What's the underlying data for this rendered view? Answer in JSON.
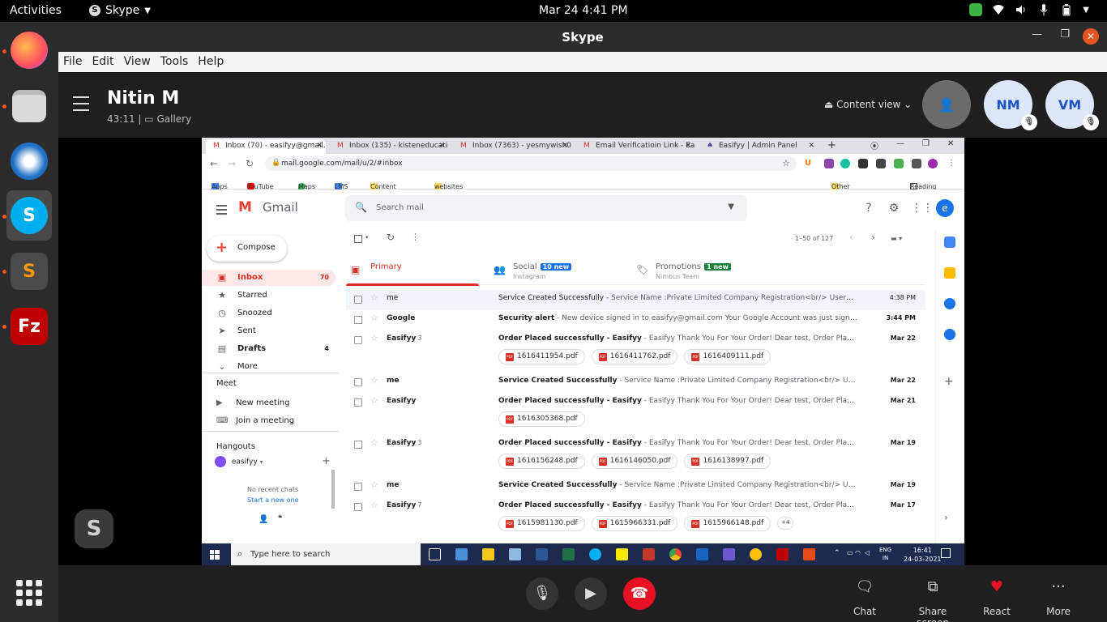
{
  "ubuntu": {
    "activities": "Activities",
    "app_name": "Skype",
    "clock": "Mar 24  4:41 PM"
  },
  "skype": {
    "window_title": "Skype",
    "menu": [
      "File",
      "Edit",
      "View",
      "Tools",
      "Help"
    ],
    "call_name": "Nitin M",
    "call_timer": "43:11",
    "call_view": "Gallery",
    "content_view_label": "Content view",
    "participants": [
      "NM",
      "VM"
    ],
    "actions": [
      "Chat",
      "Share screen",
      "React",
      "More"
    ]
  },
  "chrome": {
    "tabs": [
      "Inbox (70) - easifyy@gmail.c",
      "Inbox (135) - kisteneducation",
      "Inbox (7363) - yesmywish0@",
      "Email Verificatioin Link - Easif",
      "Easifyy | Admin Panel"
    ],
    "url": "mail.google.com/mail/u/2/#inbox",
    "bookmarks": [
      "Apps",
      "YouTube",
      "Maps",
      "LMS",
      "Content Tools",
      "websites"
    ],
    "other_bookmarks": "Other bookmarks",
    "reading_list": "Reading list"
  },
  "gmail": {
    "logo_text": "Gmail",
    "search_placeholder": "Search mail",
    "account_initial": "e",
    "compose": "Compose",
    "nav": [
      {
        "label": "Inbox",
        "count": "70"
      },
      {
        "label": "Starred",
        "count": ""
      },
      {
        "label": "Snoozed",
        "count": ""
      },
      {
        "label": "Sent",
        "count": ""
      },
      {
        "label": "Drafts",
        "count": "4"
      },
      {
        "label": "More",
        "count": ""
      }
    ],
    "meet_heading": "Meet",
    "meet_items": [
      "New meeting",
      "Join a meeting"
    ],
    "hangouts_heading": "Hangouts",
    "hangouts_user": "easifyy",
    "no_chats": "No recent chats",
    "start_chat": "Start a new one",
    "pagination": "1–50 of 127",
    "categories": [
      {
        "name": "Primary",
        "sub": "",
        "badge": ""
      },
      {
        "name": "Social",
        "sub": "Instagram",
        "badge": "10 new"
      },
      {
        "name": "Promotions",
        "sub": "Nimbus Team",
        "badge": "1 new"
      }
    ],
    "emails": [
      {
        "sender": "me",
        "count": "",
        "subject": "Service Created Successfully",
        "snippet": " - Service Name :Private Limited Company Registration<br/> UserMail:...",
        "date": "4:38 PM",
        "unread": false,
        "attachments": []
      },
      {
        "sender": "Google",
        "count": "",
        "subject": "Security alert",
        "snippet": " - New device signed in to easifyy@gmail.com Your Google Account was just signed in ...",
        "date": "3:44 PM",
        "unread": true,
        "attachments": []
      },
      {
        "sender": "Easifyy",
        "count": "3",
        "subject": "Order Placed successfully - Easifyy",
        "snippet": " - Easifyy Thank You For Your Order! Dear test, Order Placed Suc...",
        "date": "Mar 22",
        "unread": true,
        "attachments": [
          "1616411954.pdf",
          "1616411762.pdf",
          "1616409111.pdf"
        ]
      },
      {
        "sender": "me",
        "count": "",
        "subject": "Service Created Successfully",
        "snippet": " - Service Name :Private Limited Company Registration<br/> UserMail:...",
        "date": "Mar 22",
        "unread": true,
        "attachments": []
      },
      {
        "sender": "Easifyy",
        "count": "",
        "subject": "Order Placed successfully - Easifyy",
        "snippet": " - Easifyy Thank You For Your Order! Dear test, Order Placed Suc...",
        "date": "Mar 21",
        "unread": true,
        "attachments": [
          "1616305368.pdf"
        ]
      },
      {
        "sender": "Easifyy",
        "count": "3",
        "subject": "Order Placed successfully - Easifyy",
        "snippet": " - Easifyy Thank You For Your Order! Dear test, Order Placed Suc...",
        "date": "Mar 19",
        "unread": true,
        "attachments": [
          "1616156248.pdf",
          "1616146050.pdf",
          "1616138997.pdf"
        ]
      },
      {
        "sender": "me",
        "count": "",
        "subject": "Service Created Successfully",
        "snippet": " - Service Name :Private Limited Company Registration<br/> UserMail:...",
        "date": "Mar 19",
        "unread": true,
        "attachments": []
      },
      {
        "sender": "Easifyy",
        "count": "7",
        "subject": "Order Placed successfully - Easifyy",
        "snippet": " - Easifyy Thank You For Your Order! Dear test, Order Placed Suc...",
        "date": "Mar 17",
        "unread": true,
        "attachments": [
          "1615981130.pdf",
          "1615966331.pdf",
          "1615966148.pdf"
        ],
        "more": "+4"
      }
    ]
  },
  "windows": {
    "search_placeholder": "Type here to search",
    "lang_1": "ENG",
    "lang_2": "IN",
    "time": "16:41",
    "date": "24-03-2021"
  },
  "colors": {
    "gmail_red": "#d93025",
    "hangup": "#e81123",
    "ubuntu_accent": "#e95420",
    "avatar_bg": "#dde6fa",
    "avatar_fg": "#1a55c7"
  }
}
